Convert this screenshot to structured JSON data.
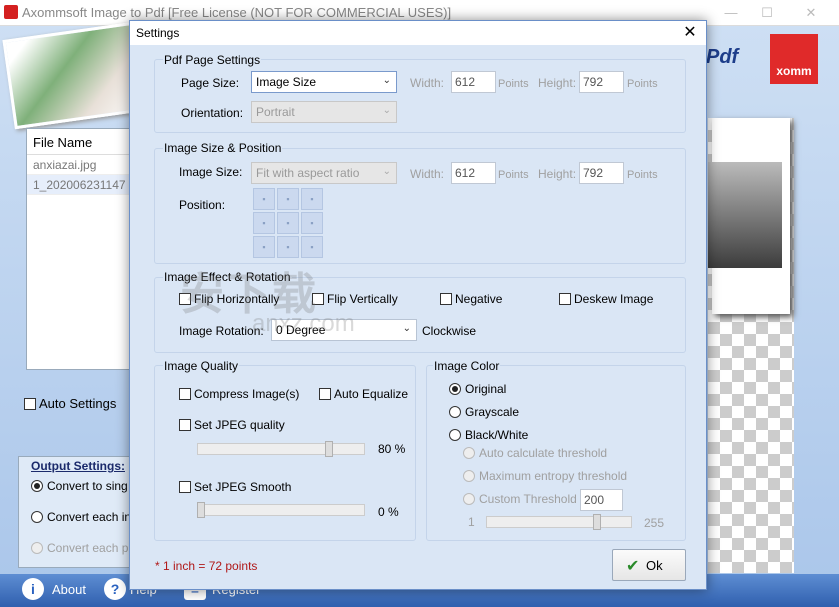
{
  "main": {
    "title": "Axommsoft Image to Pdf [Free License (NOT FOR COMMERCIAL USES)]",
    "banner_word": "Pdf",
    "logo_text": "xomm",
    "file_list": {
      "header": "File Name",
      "files": [
        "anxiazai.jpg",
        "1_202006231147"
      ]
    },
    "auto_settings_label": "Auto Settings",
    "output": {
      "title": "Output Settings:",
      "options": [
        "Convert to sing",
        "Convert each in",
        "Convert each p"
      ],
      "selected_index": 0
    },
    "bottom_bar": {
      "about": "About",
      "help": "Help",
      "register": "Register"
    }
  },
  "dialog": {
    "title": "Settings",
    "close_glyph": "✕",
    "pdf_page": {
      "title": "Pdf Page Settings",
      "page_size_label": "Page Size:",
      "page_size_value": "Image Size",
      "width_label": "Width:",
      "width_value": "612",
      "height_label": "Height:",
      "height_value": "792",
      "unit": "Points",
      "orientation_label": "Orientation:",
      "orientation_value": "Portrait"
    },
    "image_size": {
      "title": "Image Size & Position",
      "size_label": "Image Size:",
      "size_value": "Fit with aspect ratio",
      "width_label": "Width:",
      "width_value": "612",
      "height_label": "Height:",
      "height_value": "792",
      "unit": "Points",
      "position_label": "Position:"
    },
    "effect": {
      "title": "Image Effect & Rotation",
      "flip_h": "Flip Horizontally",
      "flip_v": "Flip Vertically",
      "negative": "Negative",
      "deskew": "Deskew Image",
      "rotation_label": "Image Rotation:",
      "rotation_value": "0 Degree",
      "clockwise": "Clockwise"
    },
    "quality": {
      "title": "Image Quality",
      "compress": "Compress Image(s)",
      "auto_equalize": "Auto Equalize",
      "jpeg_quality": "Set JPEG quality",
      "jpeg_quality_value": "80 %",
      "jpeg_quality_level": 0.8,
      "jpeg_smooth": "Set JPEG Smooth",
      "jpeg_smooth_value": "0 %",
      "jpeg_smooth_level": 0
    },
    "color": {
      "title": "Image Color",
      "original": "Original",
      "grayscale": "Grayscale",
      "bw": "Black/White",
      "auto_threshold": "Auto calculate threshold",
      "max_entropy": "Maximum entropy threshold",
      "custom_threshold": "Custom Threshold",
      "custom_threshold_value": "200",
      "slider_min": "1",
      "slider_max": "255"
    },
    "footnote": "* 1 inch = 72 points",
    "ok_label": "Ok"
  },
  "watermark": {
    "main": "安下载",
    "sub": "anxz.com"
  },
  "colors": {
    "footnote": "#b01818",
    "ok_check": "#2a8a2a",
    "bottom_bar": "#2f5fae"
  }
}
